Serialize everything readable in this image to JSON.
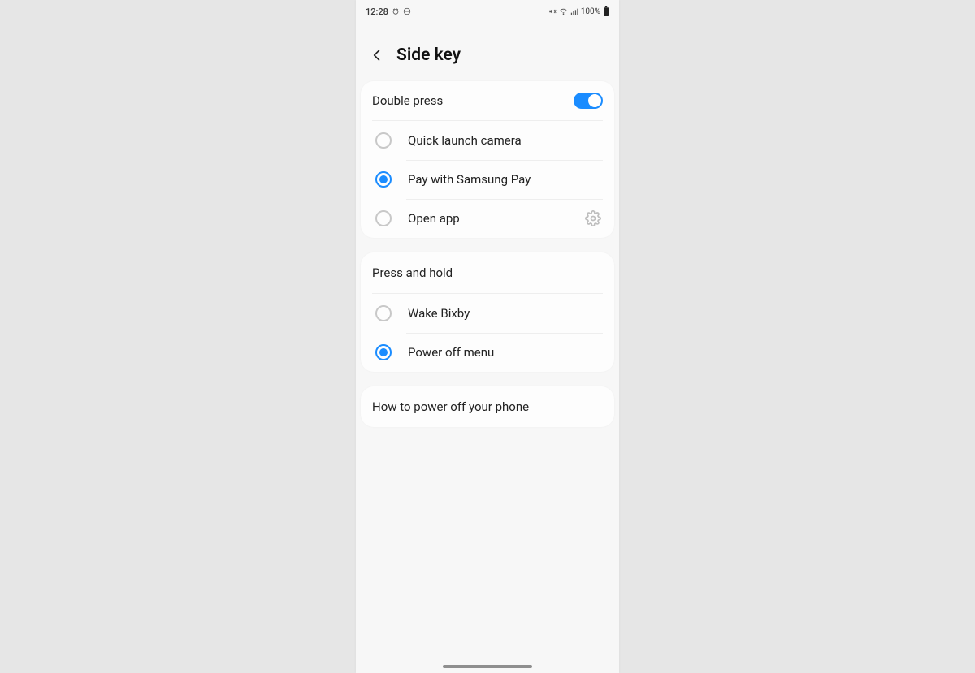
{
  "status": {
    "time": "12:28",
    "battery_text": "100%"
  },
  "header": {
    "title": "Side key"
  },
  "doublePress": {
    "label": "Double press",
    "enabled": true,
    "options": [
      {
        "label": "Quick launch camera",
        "selected": false,
        "hasSettings": false
      },
      {
        "label": "Pay with Samsung Pay",
        "selected": true,
        "hasSettings": false
      },
      {
        "label": "Open app",
        "selected": false,
        "hasSettings": true
      }
    ]
  },
  "pressHold": {
    "label": "Press and hold",
    "options": [
      {
        "label": "Wake Bixby",
        "selected": false
      },
      {
        "label": "Power off menu",
        "selected": true
      }
    ]
  },
  "help": {
    "label": "How to power off your phone"
  },
  "colors": {
    "accent": "#1a8cff"
  }
}
